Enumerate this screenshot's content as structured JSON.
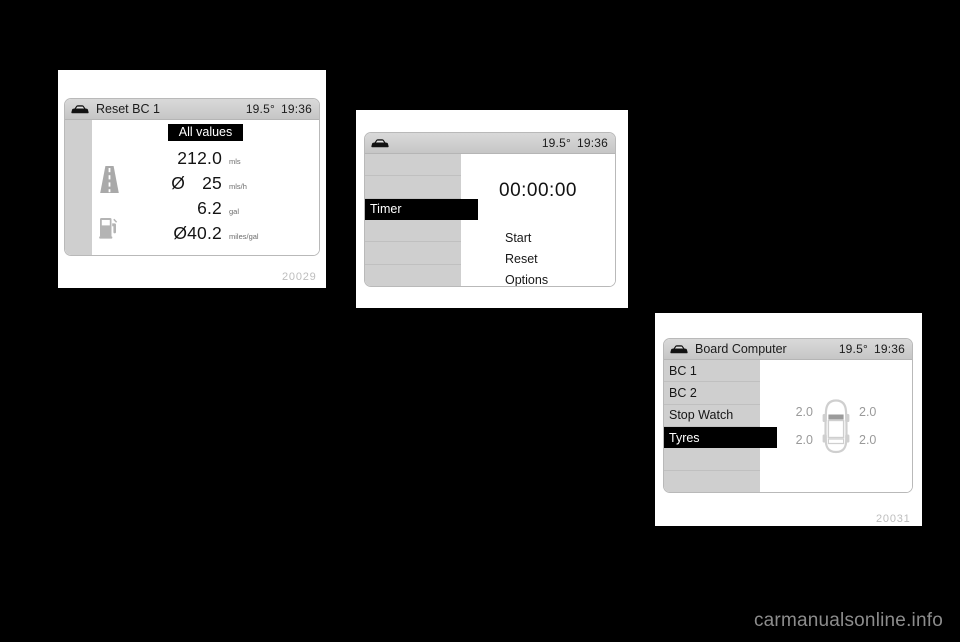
{
  "page": {
    "background_color": "#000000",
    "watermark": "carmanualsonline.info"
  },
  "figures": [
    {
      "id": "fig1",
      "number": "20029",
      "header": {
        "icon": "car-front-icon",
        "title": "Reset BC 1",
        "temperature": "19.5°",
        "time": "19:36"
      },
      "banner": "All values",
      "rows": [
        {
          "icon": "road-icon",
          "prefix": "",
          "value": "212.0",
          "unit": "mls"
        },
        {
          "icon": "",
          "prefix": "Ø",
          "value": "25",
          "unit": "mls/h"
        },
        {
          "icon": "fuel-pump-icon",
          "prefix": "",
          "value": "6.2",
          "unit": "gal"
        },
        {
          "icon": "",
          "prefix": "Ø",
          "value": "40.2",
          "unit": "miles/gal"
        }
      ]
    },
    {
      "id": "fig2",
      "number": "",
      "header": {
        "icon": "car-front-icon",
        "title": "",
        "temperature": "19.5°",
        "time": "19:36"
      },
      "menu": [
        {
          "label": "",
          "selected": false
        },
        {
          "label": "",
          "selected": false
        },
        {
          "label": "Timer",
          "selected": true
        },
        {
          "label": "",
          "selected": false
        },
        {
          "label": "",
          "selected": false
        },
        {
          "label": "",
          "selected": false
        }
      ],
      "timer_value": "00:00:00",
      "actions": [
        "Start",
        "Reset",
        "Options"
      ]
    },
    {
      "id": "fig3",
      "number": "20031",
      "header": {
        "icon": "car-front-icon",
        "title": "Board Computer",
        "temperature": "19.5°",
        "time": "19:36"
      },
      "menu": [
        {
          "label": "BC 1",
          "selected": false
        },
        {
          "label": "BC 2",
          "selected": false
        },
        {
          "label": "Stop Watch",
          "selected": false
        },
        {
          "label": "Tyres",
          "selected": true
        },
        {
          "label": "",
          "selected": false
        },
        {
          "label": "",
          "selected": false
        }
      ],
      "tyres": {
        "front_left": "2.0",
        "front_right": "2.0",
        "rear_left": "2.0",
        "rear_right": "2.0",
        "graphic": "car-top-view-icon"
      }
    }
  ]
}
